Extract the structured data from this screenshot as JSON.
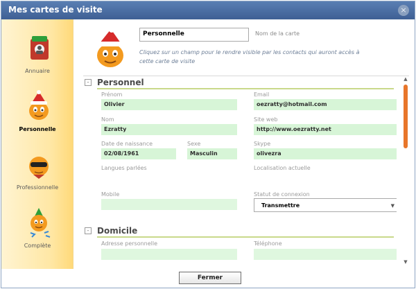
{
  "window": {
    "title": "Mes cartes de visite",
    "close_glyph": "×"
  },
  "sidebar": {
    "items": [
      {
        "label": "Annuaire",
        "icon": "address-book-icon",
        "active": false
      },
      {
        "label": "Personnelle",
        "icon": "personal-avatar-icon",
        "active": true
      },
      {
        "label": "Professionnelle",
        "icon": "professional-avatar-icon",
        "active": false
      },
      {
        "label": "Complète",
        "icon": "complete-avatar-icon",
        "active": false
      }
    ]
  },
  "card": {
    "name_value": "Personnelle",
    "name_label": "Nom de la carte",
    "hint": "Cliquez sur un champ pour le rendre visible par les contacts qui auront accès à cette carte de visite"
  },
  "personnel": {
    "title": "Personnel",
    "toggle": "-",
    "fields": {
      "prenom": {
        "label": "Prénom",
        "value": "Olivier"
      },
      "email": {
        "label": "Email",
        "value": "oezratty@hotmail.com"
      },
      "nom": {
        "label": "Nom",
        "value": "Ezratty"
      },
      "site": {
        "label": "Site web",
        "value": "http://www.oezratty.net"
      },
      "naissance": {
        "label": "Date de naissance",
        "value": "02/08/1961"
      },
      "sexe": {
        "label": "Sexe",
        "value": "Masculin"
      },
      "skype": {
        "label": "Skype",
        "value": "olivezra"
      },
      "langues": {
        "label": "Langues parlées",
        "value": ""
      },
      "localisation": {
        "label": "Localisation actuelle",
        "value": ""
      },
      "mobile": {
        "label": "Mobile",
        "value": ""
      },
      "statut": {
        "label": "Statut de connexion",
        "value": "Transmettre"
      }
    }
  },
  "domicile": {
    "title": "Domicile",
    "toggle": "-",
    "fields": {
      "adresse": {
        "label": "Adresse personnelle",
        "value": ""
      },
      "telephone": {
        "label": "Téléphone",
        "value": ""
      }
    }
  },
  "footer": {
    "close_label": "Fermer"
  },
  "colors": {
    "accent": "#e8762b",
    "field_bg": "#d7f5d7",
    "titlebar": "#4a6fa5",
    "section_line": "#c9d98a"
  }
}
